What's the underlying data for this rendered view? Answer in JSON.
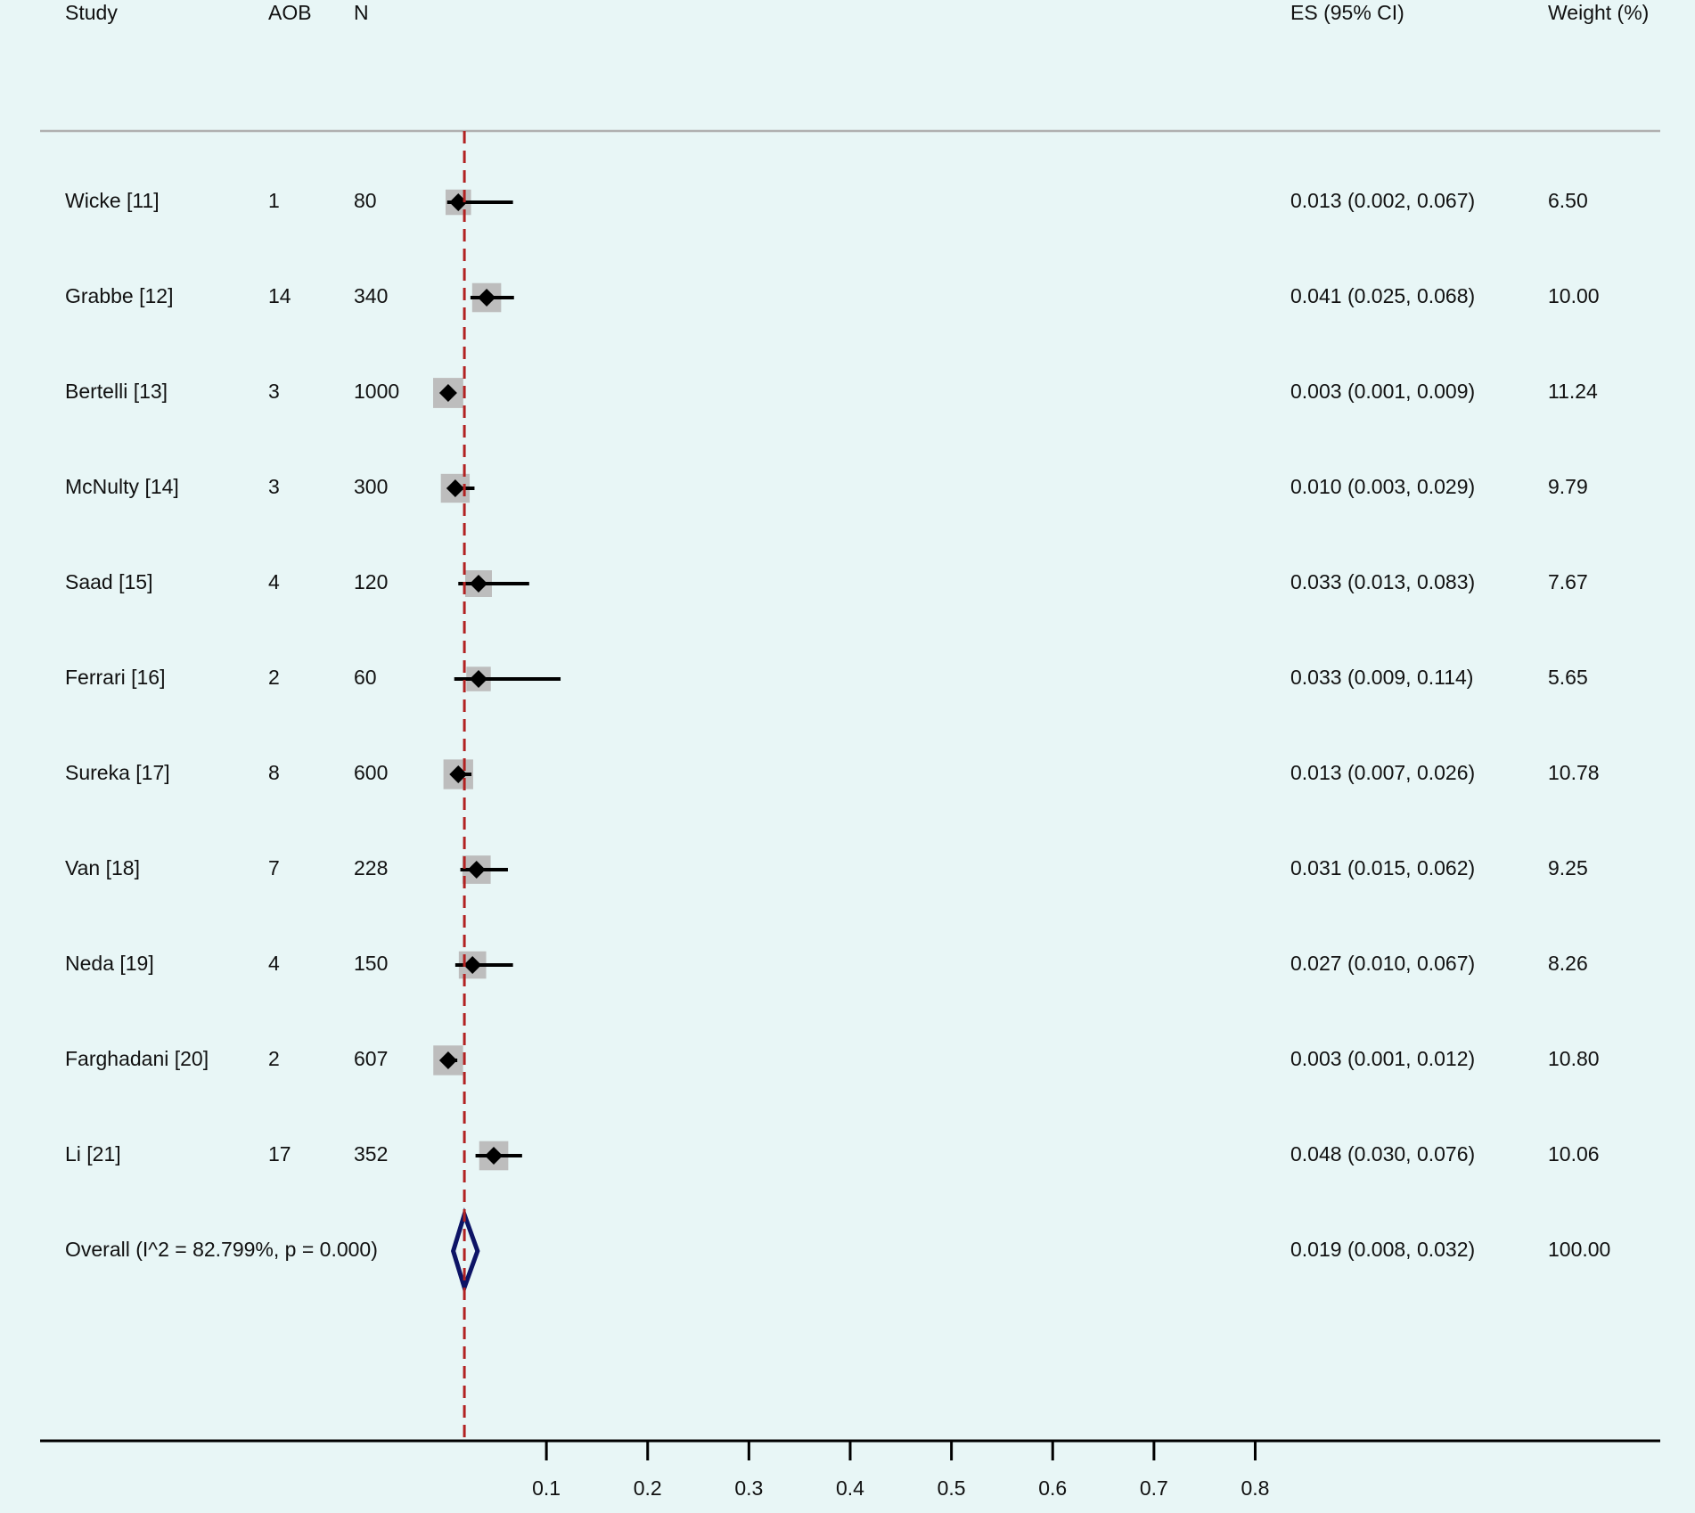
{
  "colors": {
    "background": "#e8f6f6",
    "marker": "#000000",
    "weight_box": "#bdbdbd",
    "reference_line": "#b22222",
    "overall_diamond": "#0d1466",
    "separator": "#b0b0b0"
  },
  "chart_data": {
    "type": "forest",
    "headers": {
      "study": "Study",
      "aob": "AOB",
      "n": "N",
      "es": "ES (95% CI)",
      "weight": "Weight (%)"
    },
    "studies": [
      {
        "study": "Wicke [11]",
        "aob": "1",
        "n": "80",
        "es": 0.013,
        "lo": 0.002,
        "hi": 0.067,
        "es_text": "0.013 (0.002, 0.067)",
        "weight": 6.5,
        "weight_text": "6.50"
      },
      {
        "study": "Grabbe [12]",
        "aob": "14",
        "n": "340",
        "es": 0.041,
        "lo": 0.025,
        "hi": 0.068,
        "es_text": "0.041 (0.025, 0.068)",
        "weight": 10.0,
        "weight_text": "10.00"
      },
      {
        "study": "Bertelli [13]",
        "aob": "3",
        "n": "1000",
        "es": 0.003,
        "lo": 0.001,
        "hi": 0.009,
        "es_text": "0.003 (0.001, 0.009)",
        "weight": 11.24,
        "weight_text": "11.24"
      },
      {
        "study": "McNulty [14]",
        "aob": "3",
        "n": "300",
        "es": 0.01,
        "lo": 0.003,
        "hi": 0.029,
        "es_text": "0.010 (0.003, 0.029)",
        "weight": 9.79,
        "weight_text": "9.79"
      },
      {
        "study": "Saad [15]",
        "aob": "4",
        "n": "120",
        "es": 0.033,
        "lo": 0.013,
        "hi": 0.083,
        "es_text": "0.033 (0.013, 0.083)",
        "weight": 7.67,
        "weight_text": "7.67"
      },
      {
        "study": "Ferrari [16]",
        "aob": "2",
        "n": "60",
        "es": 0.033,
        "lo": 0.009,
        "hi": 0.114,
        "es_text": "0.033 (0.009, 0.114)",
        "weight": 5.65,
        "weight_text": "5.65"
      },
      {
        "study": "Sureka [17]",
        "aob": "8",
        "n": "600",
        "es": 0.013,
        "lo": 0.007,
        "hi": 0.026,
        "es_text": "0.013 (0.007, 0.026)",
        "weight": 10.78,
        "weight_text": "10.78"
      },
      {
        "study": "Van [18]",
        "aob": "7",
        "n": "228",
        "es": 0.031,
        "lo": 0.015,
        "hi": 0.062,
        "es_text": "0.031 (0.015, 0.062)",
        "weight": 9.25,
        "weight_text": "9.25"
      },
      {
        "study": "Neda [19]",
        "aob": "4",
        "n": "150",
        "es": 0.027,
        "lo": 0.01,
        "hi": 0.067,
        "es_text": "0.027 (0.010, 0.067)",
        "weight": 8.26,
        "weight_text": "8.26"
      },
      {
        "study": "Farghadani [20]",
        "aob": "2",
        "n": "607",
        "es": 0.003,
        "lo": 0.001,
        "hi": 0.012,
        "es_text": "0.003 (0.001, 0.012)",
        "weight": 10.8,
        "weight_text": "10.80"
      },
      {
        "study": "Li [21]",
        "aob": "17",
        "n": "352",
        "es": 0.048,
        "lo": 0.03,
        "hi": 0.076,
        "es_text": "0.048 (0.030, 0.076)",
        "weight": 10.06,
        "weight_text": "10.06"
      }
    ],
    "overall": {
      "label": "Overall  (I^2 = 82.799%, p = 0.000)",
      "es": 0.019,
      "lo": 0.008,
      "hi": 0.032,
      "es_text": "0.019 (0.008, 0.032)",
      "weight_text": "100.00"
    },
    "reference_value": 0.019,
    "x_ticks": [
      0.1,
      0.2,
      0.3,
      0.4,
      0.5,
      0.6,
      0.7,
      0.8
    ],
    "x_tick_labels": [
      "0.1",
      "0.2",
      "0.3",
      "0.4",
      "0.5",
      "0.6",
      "0.7",
      "0.8"
    ],
    "xlim": [
      -0.4,
      1.2
    ],
    "title": "",
    "xlabel": "",
    "ylabel": ""
  }
}
